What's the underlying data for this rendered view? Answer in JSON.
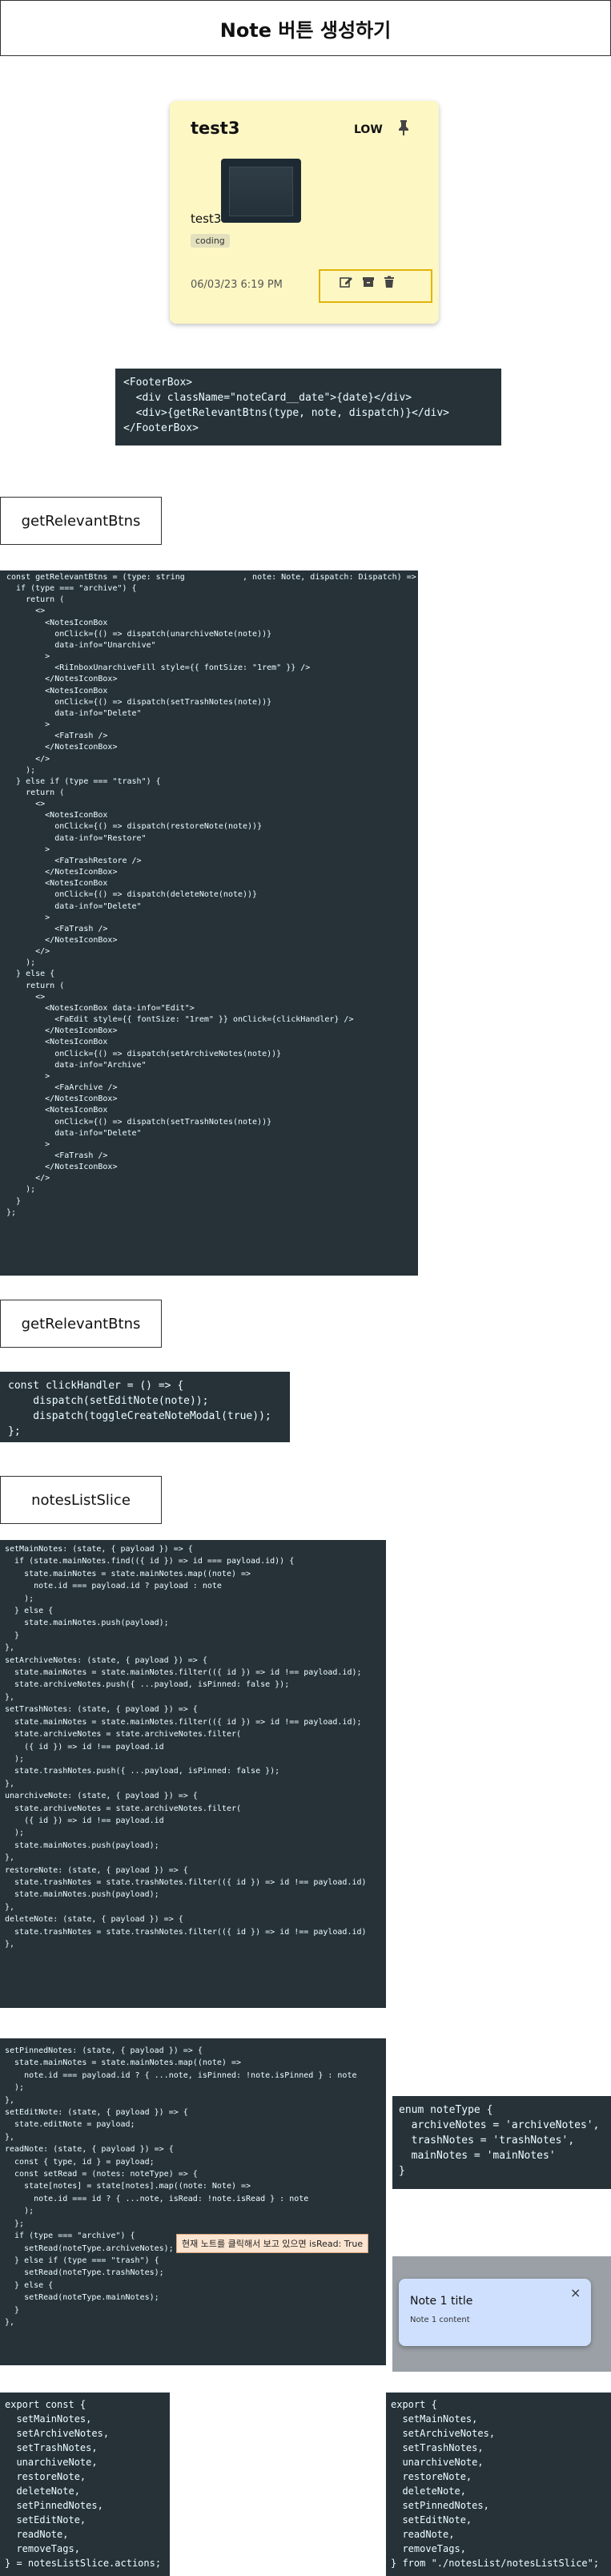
{
  "header": {
    "title": "Note 버튼 생성하기"
  },
  "note_card": {
    "title": "test3",
    "priority": "LOW",
    "pin_icon": "pin-icon",
    "content": "test3",
    "tag": "coding",
    "date": "06/03/23 6:19 PM",
    "icons": [
      "edit-icon",
      "archive-icon",
      "trash-icon"
    ]
  },
  "footer_code": [
    "<FooterBox>",
    "  <div className=\"noteCard__date\">{date}</div>",
    "  <div>{getRelevantBtns(type, note, dispatch)}</div>",
    "</FooterBox>"
  ],
  "section1": {
    "title": "getRelevantBtns"
  },
  "code_relevant": [
    "const getRelevantBtns = (type: string            , note: Note, dispatch: Dispatch) => {",
    "  if (type === \"archive\") {",
    "    return (",
    "      <>",
    "        <NotesIconBox",
    "          onClick={() => dispatch(unarchiveNote(note))}",
    "          data-info=\"Unarchive\"",
    "        >",
    "          <RiInboxUnarchiveFill style={{ fontSize: \"1rem\" }} />",
    "        </NotesIconBox>",
    "        <NotesIconBox",
    "          onClick={() => dispatch(setTrashNotes(note))}",
    "          data-info=\"Delete\"",
    "        >",
    "          <FaTrash />",
    "        </NotesIconBox>",
    "      </>",
    "    );",
    "  } else if (type === \"trash\") {",
    "    return (",
    "      <>",
    "        <NotesIconBox",
    "          onClick={() => dispatch(restoreNote(note))}",
    "          data-info=\"Restore\"",
    "        >",
    "          <FaTrashRestore />",
    "        </NotesIconBox>",
    "        <NotesIconBox",
    "          onClick={() => dispatch(deleteNote(note))}",
    "          data-info=\"Delete\"",
    "        >",
    "          <FaTrash />",
    "        </NotesIconBox>",
    "      </>",
    "    );",
    "  } else {",
    "    return (",
    "      <>",
    "        <NotesIconBox data-info=\"Edit\">",
    "          <FaEdit style={{ fontSize: \"1rem\" }} onClick={clickHandler} />",
    "        </NotesIconBox>",
    "        <NotesIconBox",
    "          onClick={() => dispatch(setArchiveNotes(note))}",
    "          data-info=\"Archive\"",
    "        >",
    "          <FaArchive />",
    "        </NotesIconBox>",
    "        <NotesIconBox",
    "          onClick={() => dispatch(setTrashNotes(note))}",
    "          data-info=\"Delete\"",
    "        >",
    "          <FaTrash />",
    "        </NotesIconBox>",
    "      </>",
    "    );",
    "  }",
    "};"
  ],
  "section2": {
    "title": "getRelevantBtns"
  },
  "code_click": [
    "const clickHandler = () => {",
    "    dispatch(setEditNote(note));",
    "    dispatch(toggleCreateNoteModal(true));",
    "};"
  ],
  "section3": {
    "title": "notesListSlice"
  },
  "code_slice1": [
    "setMainNotes: (state, { payload }) => {",
    "  if (state.mainNotes.find(({ id }) => id === payload.id)) {",
    "    state.mainNotes = state.mainNotes.map((note) =>",
    "      note.id === payload.id ? payload : note",
    "    );",
    "  } else {",
    "    state.mainNotes.push(payload);",
    "  }",
    "},",
    "",
    "setArchiveNotes: (state, { payload }) => {",
    "  state.mainNotes = state.mainNotes.filter(({ id }) => id !== payload.id);",
    "  state.archiveNotes.push({ ...payload, isPinned: false });",
    "},",
    "",
    "setTrashNotes: (state, { payload }) => {",
    "  state.mainNotes = state.mainNotes.filter(({ id }) => id !== payload.id);",
    "  state.archiveNotes = state.archiveNotes.filter(",
    "    ({ id }) => id !== payload.id",
    "  );",
    "  state.trashNotes.push({ ...payload, isPinned: false });",
    "},",
    "",
    "unarchiveNote: (state, { payload }) => {",
    "  state.archiveNotes = state.archiveNotes.filter(",
    "    ({ id }) => id !== payload.id",
    "  );",
    "  state.mainNotes.push(payload);",
    "},",
    "",
    "restoreNote: (state, { payload }) => {",
    "  state.trashNotes = state.trashNotes.filter(({ id }) => id !== payload.id)",
    "  state.mainNotes.push(payload);",
    "},",
    "deleteNote: (state, { payload }) => {",
    "  state.trashNotes = state.trashNotes.filter(({ id }) => id !== payload.id)",
    "},"
  ],
  "code_slice2": [
    "setPinnedNotes: (state, { payload }) => {",
    "  state.mainNotes = state.mainNotes.map((note) =>",
    "    note.id === payload.id ? { ...note, isPinned: !note.isPinned } : note",
    "  );",
    "},",
    "setEditNote: (state, { payload }) => {",
    "  state.editNote = payload;",
    "},",
    "readNote: (state, { payload }) => {",
    "  const { type, id } = payload;",
    "",
    "  const setRead = (notes: noteType) => {",
    "    state[notes] = state[notes].map((note: Note) =>",
    "      note.id === id ? { ...note, isRead: !note.isRead } : note",
    "    );",
    "  };",
    "",
    "  if (type === \"archive\") {",
    "    setRead(noteType.archiveNotes);",
    "  } else if (type === \"trash\") {",
    "    setRead(noteType.trashNotes);",
    "  } else {",
    "    setRead(noteType.mainNotes);",
    "  }",
    "},"
  ],
  "annotation": "현재 노트를 클릭해서 보고 있으면 isRead: True",
  "code_enum": [
    "enum noteType {",
    "  archiveNotes = 'archiveNotes',",
    "  trashNotes = 'trashNotes',",
    "  mainNotes = 'mainNotes'",
    "}"
  ],
  "modal": {
    "title": "Note 1 title",
    "content": "Note 1 content",
    "close": "×"
  },
  "code_exports1": [
    "export const {",
    "  setMainNotes,",
    "  setArchiveNotes,",
    "  setTrashNotes,",
    "  unarchiveNote,",
    "  restoreNote,",
    "  deleteNote,",
    "  setPinnedNotes,",
    "  setEditNote,",
    "  readNote,",
    "  removeTags,",
    "} = notesListSlice.actions;"
  ],
  "code_exports2": [
    "export {",
    "  setMainNotes,",
    "  setArchiveNotes,",
    "  setTrashNotes,",
    "  unarchiveNote,",
    "  restoreNote,",
    "  deleteNote,",
    "  setPinnedNotes,",
    "  setEditNote,",
    "  readNote,",
    "  removeTags,",
    "} from \"./notesList/notesListSlice\";"
  ]
}
